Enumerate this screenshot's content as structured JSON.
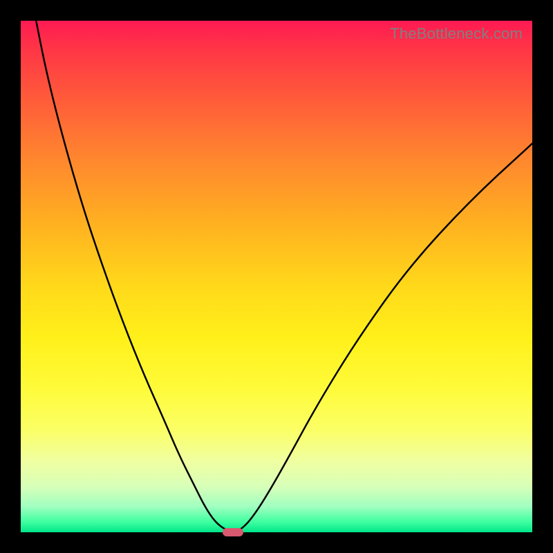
{
  "watermark": "TheBottleneck.com",
  "colors": {
    "frame_bg": "#000000",
    "curve_stroke": "#000000",
    "marker_fill": "#d9596f",
    "watermark_text": "#808080"
  },
  "chart_data": {
    "type": "line",
    "title": "",
    "xlabel": "",
    "ylabel": "",
    "xlim": [
      0,
      100
    ],
    "ylim": [
      0,
      100
    ],
    "grid": false,
    "legend": false,
    "series": [
      {
        "name": "bottleneck-curve",
        "x": [
          3,
          5,
          8,
          12,
          16,
          20,
          24,
          28,
          31,
          34,
          36,
          38,
          40,
          41.5,
          43,
          45,
          48,
          52,
          58,
          66,
          76,
          88,
          100
        ],
        "values": [
          100,
          90,
          78,
          64,
          52,
          41,
          31,
          22,
          15,
          9,
          5,
          2,
          0.5,
          0,
          0.5,
          2.5,
          7,
          14,
          25,
          38,
          52,
          65,
          76
        ]
      }
    ],
    "marker": {
      "x": 41.5,
      "y": 0,
      "width_pct": 4.1,
      "height_pct": 1.5
    }
  }
}
